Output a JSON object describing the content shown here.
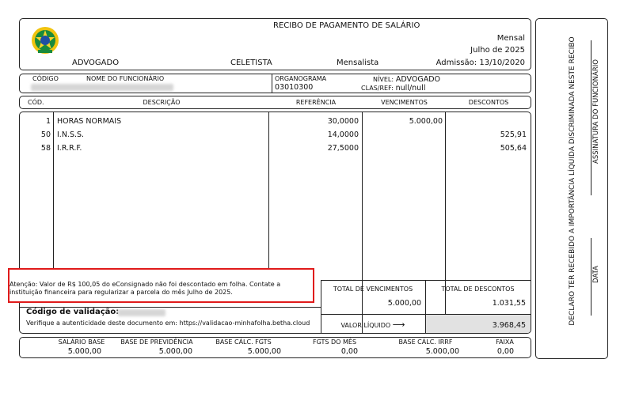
{
  "header": {
    "title": "RECIBO DE PAGAMENTO DE SALÁRIO",
    "type": "Mensal",
    "period": "Julho de 2025",
    "position": "ADVOGADO",
    "regime": "CELETISTA",
    "category": "Mensalista",
    "admission_label": "Admissão:",
    "admission_date": "13/10/2020"
  },
  "employee": {
    "code_label": "CÓDIGO",
    "name_label": "NOME DO FUNCIONÁRIO",
    "org_label": "ORGANOGRAMA",
    "org_value": "03010300",
    "level_label": "NÍVEL:",
    "level_value": "ADVOGADO",
    "clasref_label": "CLAS/REF:",
    "clasref_value": "null/null"
  },
  "table": {
    "headers": {
      "code": "CÓD.",
      "description": "DESCRIÇÃO",
      "reference": "REFERÊNCIA",
      "earnings": "VENCIMENTOS",
      "deductions": "DESCONTOS"
    },
    "rows": [
      {
        "code": "1",
        "description": "HORAS NORMAIS",
        "reference": "30,0000",
        "earnings": "5.000,00",
        "deductions": ""
      },
      {
        "code": "50",
        "description": "I.N.S.S.",
        "reference": "14,0000",
        "earnings": "",
        "deductions": "525,91"
      },
      {
        "code": "58",
        "description": "I.R.R.F.",
        "reference": "27,5000",
        "earnings": "",
        "deductions": "505,64"
      }
    ]
  },
  "notice": {
    "text_line1": "Atenção: Valor de R$ 100,05 do eConsignado não foi descontado em folha. Contate a",
    "text_line2": "instituição financeira para regularizar a parcela do mês Julho de 2025."
  },
  "validation": {
    "label": "Código de validação:",
    "text": "Verifique a autenticidade deste documento em: https://validacao-minhafolha.betha.cloud"
  },
  "totals": {
    "earnings_label": "TOTAL DE VENCIMENTOS",
    "earnings_value": "5.000,00",
    "deductions_label": "TOTAL DE DESCONTOS",
    "deductions_value": "1.031,55",
    "net_label": "VALOR LÍQUIDO",
    "net_arrow": "⟶",
    "net_value": "3.968,45"
  },
  "bases": {
    "salary_label": "SALÁRIO BASE",
    "salary_value": "5.000,00",
    "prev_label": "BASE DE PREVIDÊNCIA",
    "prev_value": "5.000,00",
    "fgts_label": "BASE CÁLC. FGTS",
    "fgts_value": "5.000,00",
    "fgts_month_label": "FGTS DO MÊS",
    "fgts_month_value": "0,00",
    "irrf_label": "BASE CÁLC. IRRF",
    "irrf_value": "5.000,00",
    "faixa_label": "FAIXA",
    "faixa_value": "0,00"
  },
  "receipt": {
    "declaration": "DECLARO TER RECEBIDO A IMPORTÂNCIA LÍQUIDA DISCRIMINADA NESTE RECIBO",
    "signature_label": "ASSINATURA DO FUNCIONÁRIO",
    "date_label": "DATA"
  },
  "colors": {
    "border": "#222222",
    "highlight": "#e01b1b",
    "net_bg": "#e2e2e2"
  }
}
